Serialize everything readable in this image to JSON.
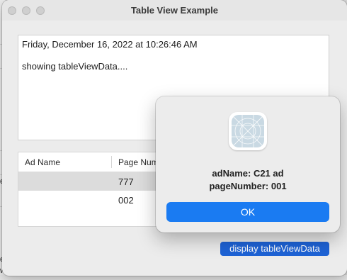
{
  "window": {
    "title": "Table View Example"
  },
  "textview": {
    "lines": [
      "Friday, December 16, 2022 at 10:26:46 AM",
      "showing tableViewData...."
    ]
  },
  "table": {
    "columns": [
      "Ad Name",
      "Page Num"
    ],
    "rows": [
      {
        "ad_name": "",
        "page_number": "777",
        "selected": true
      },
      {
        "ad_name": "",
        "page_number": "002",
        "selected": false
      }
    ]
  },
  "display_button": {
    "label": "display tableViewData"
  },
  "alert": {
    "message_line1": "adName: C21 ad",
    "message_line2": "pageNumber: 001",
    "ok_label": "OK"
  },
  "background_window": {
    "glyphs": [
      "e",
      "e",
      "w"
    ]
  },
  "colors": {
    "accent": "#1a7bf2",
    "display_button": "#1e63d6",
    "selected_row": "#dcdcdc",
    "icon_placeholder": "#c9d9e3"
  },
  "icons": [
    "close-icon",
    "minimize-icon",
    "zoom-icon",
    "app-placeholder-icon"
  ]
}
